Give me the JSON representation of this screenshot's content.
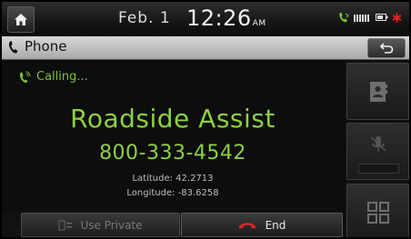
{
  "status_bar": {
    "date": "Feb.  1",
    "time": "12:26",
    "ampm": "AM"
  },
  "title_bar": {
    "title": "Phone"
  },
  "call": {
    "status": "Calling...",
    "contact_name": "Roadside Assist",
    "number": "800-333-4542",
    "latitude": "Latitude: 42.2713",
    "longitude": "Longitude: -83.6258"
  },
  "buttons": {
    "use_private": "Use Private",
    "end": "End"
  },
  "colors": {
    "accent_green": "#8cd044",
    "end_red": "#d6232a",
    "battery_red": "#e02020"
  }
}
